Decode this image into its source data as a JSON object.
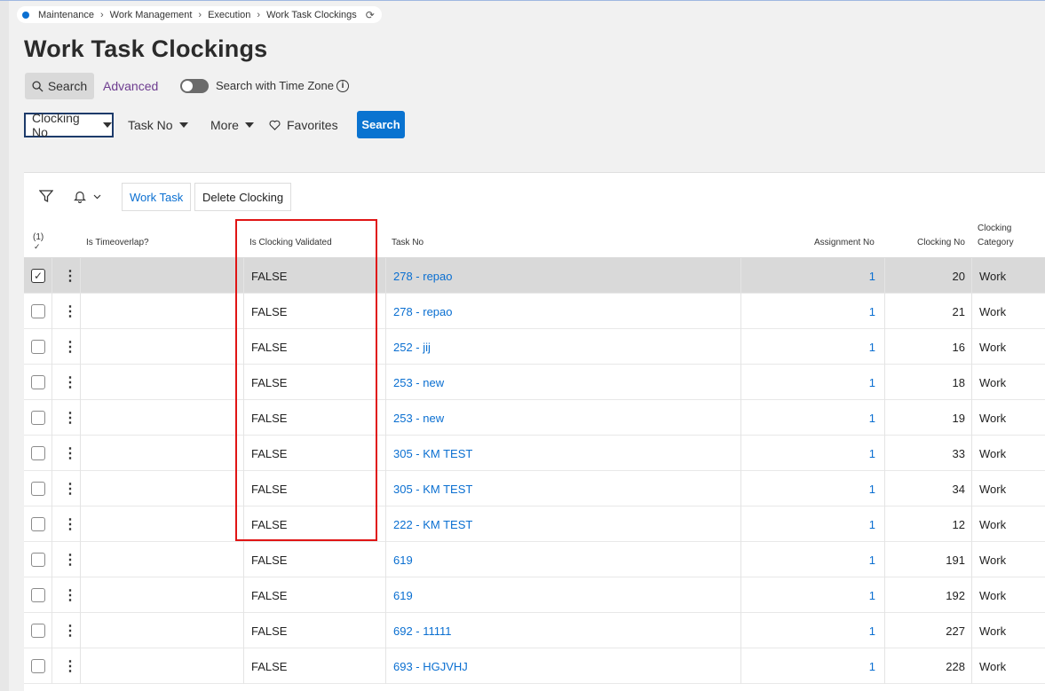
{
  "breadcrumb": [
    "Maintenance",
    "Work Management",
    "Execution",
    "Work Task Clockings"
  ],
  "icons": {
    "breadcrumb_home": "blue-dot-icon",
    "refresh": "refresh-icon",
    "search": "magnifier-icon",
    "info": "info-icon",
    "caret": "caret-down-icon",
    "favorites": "heart-icon",
    "filter": "funnel-icon",
    "notify": "bell-icon",
    "chevron": "chevron-down-icon",
    "row_menu": "kebab-icon"
  },
  "page": {
    "title": "Work Task Clockings"
  },
  "search": {
    "tab_label": "Search",
    "advanced_label": "Advanced",
    "timezone_label": "Search with Time Zone",
    "filters": [
      "Clocking No",
      "Task No",
      "More"
    ],
    "favorites_label": "Favorites",
    "search_button": "Search"
  },
  "toolbar": {
    "work_task": "Work Task",
    "delete_clocking": "Delete Clocking"
  },
  "table": {
    "selection_count": "(1)",
    "columns": {
      "timeoverlap": "Is Timeoverlap?",
      "validated": "Is Clocking Validated",
      "task_no": "Task No",
      "assignment_no": "Assignment No",
      "clocking_no": "Clocking No",
      "category_line1": "Clocking",
      "category_line2": "Category"
    },
    "rows": [
      {
        "validated": "FALSE",
        "task": "278 - repao",
        "assignment": "1",
        "clocking": "20",
        "category": "Work"
      },
      {
        "validated": "FALSE",
        "task": "278 - repao",
        "assignment": "1",
        "clocking": "21",
        "category": "Work"
      },
      {
        "validated": "FALSE",
        "task": "252 - jij",
        "assignment": "1",
        "clocking": "16",
        "category": "Work"
      },
      {
        "validated": "FALSE",
        "task": "253 - new",
        "assignment": "1",
        "clocking": "18",
        "category": "Work"
      },
      {
        "validated": "FALSE",
        "task": "253 - new",
        "assignment": "1",
        "clocking": "19",
        "category": "Work"
      },
      {
        "validated": "FALSE",
        "task": "305 - KM TEST",
        "assignment": "1",
        "clocking": "33",
        "category": "Work"
      },
      {
        "validated": "FALSE",
        "task": "305 - KM TEST",
        "assignment": "1",
        "clocking": "34",
        "category": "Work"
      },
      {
        "validated": "FALSE",
        "task": "222 - KM TEST",
        "assignment": "1",
        "clocking": "12",
        "category": "Work"
      },
      {
        "validated": "FALSE",
        "task": "619",
        "assignment": "1",
        "clocking": "191",
        "category": "Work"
      },
      {
        "validated": "FALSE",
        "task": "619",
        "assignment": "1",
        "clocking": "192",
        "category": "Work"
      },
      {
        "validated": "FALSE",
        "task": "692 - 11111",
        "assignment": "1",
        "clocking": "227",
        "category": "Work"
      },
      {
        "validated": "FALSE",
        "task": "693 - HGJVHJ",
        "assignment": "1",
        "clocking": "228",
        "category": "Work"
      }
    ]
  },
  "colors": {
    "accent": "#0a73d0",
    "link": "#0a6fd1",
    "advanced": "#6d3c8f",
    "highlight": "#e01515"
  }
}
